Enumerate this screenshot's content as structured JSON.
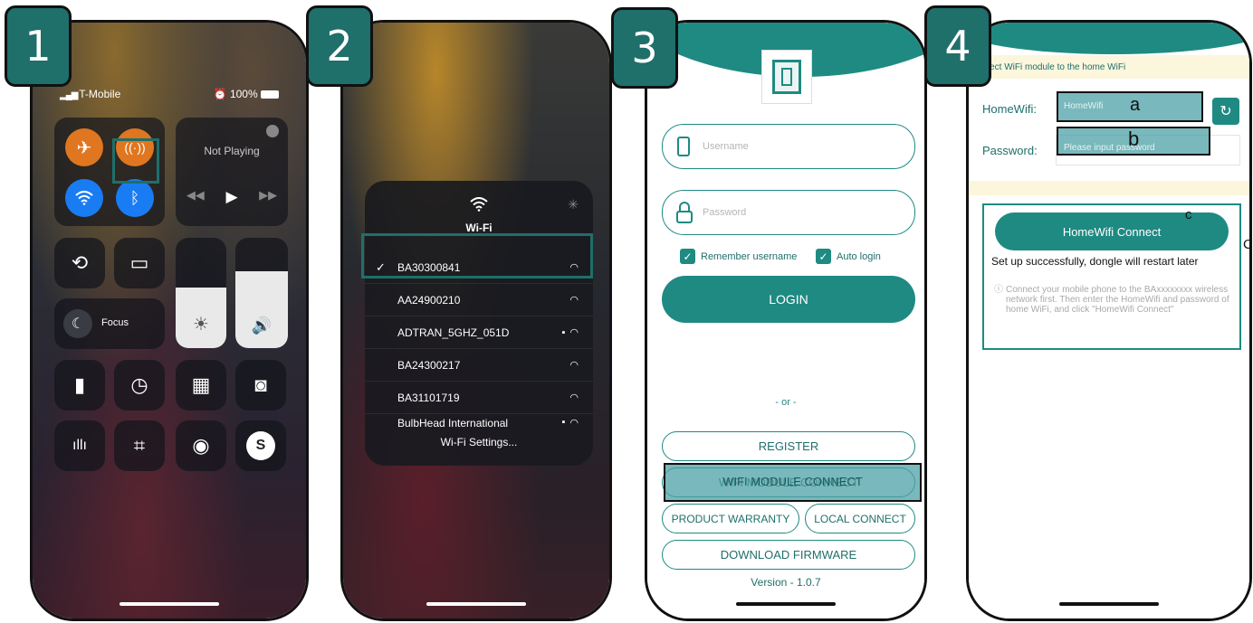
{
  "steps": [
    "1",
    "2",
    "3",
    "4"
  ],
  "phone1": {
    "carrier": "T-Mobile",
    "battery": "100%",
    "now_playing": "Not Playing",
    "focus_label": "Focus"
  },
  "phone2": {
    "wifi_title": "Wi-Fi",
    "networks": [
      {
        "name": "BA30300841",
        "selected": true,
        "locked": false
      },
      {
        "name": "AA24900210",
        "selected": false,
        "locked": false
      },
      {
        "name": "ADTRAN_5GHZ_051D",
        "selected": false,
        "locked": true
      },
      {
        "name": "BA24300217",
        "selected": false,
        "locked": false
      },
      {
        "name": "BA31101719",
        "selected": false,
        "locked": false
      },
      {
        "name": "BulbHead International",
        "selected": false,
        "locked": true
      }
    ],
    "settings_label": "Wi-Fi Settings...",
    "check_mark": "✓"
  },
  "phone3": {
    "username_placeholder": "Username",
    "password_placeholder": "Password",
    "remember_username": "Remember username",
    "auto_login": "Auto login",
    "login_button": "LOGIN",
    "or_separator": "- or -",
    "register_button": "REGISTER",
    "wifi_module_button": "WIFI MODULE CONNECT",
    "product_warranty_button": "PRODUCT WARRANTY",
    "local_connect_button": "LOCAL CONNECT",
    "download_firmware_button": "DOWNLOAD FIRMWARE",
    "version": "Version - 1.0.7"
  },
  "phone4": {
    "banner": "nnect WiFi module to the home WiFi",
    "homewifi_label": "HomeWifi:",
    "homewifi_placeholder": "HomeWifi",
    "password_label": "Password:",
    "password_placeholder": "Please input password",
    "connect_button": "HomeWifi Connect",
    "success_message": "Set up successfully, dongle will restart later",
    "info_text": "Connect your mobile phone to the BAxxxxxxxx wireless network first. Then enter the HomeWifi and password of home WiFi, and click \"HomeWifi Connect\"",
    "annotation_a": "a",
    "annotation_b": "b",
    "annotation_c_inner": "c",
    "annotation_c_outer": "C"
  },
  "colors": {
    "teal": "#1f8a82",
    "badge": "#1f6f6b",
    "ios_orange": "#e0761f",
    "ios_blue": "#1a7cf2"
  }
}
